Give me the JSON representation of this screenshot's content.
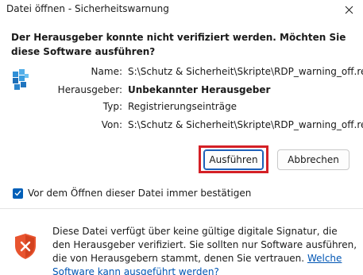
{
  "window": {
    "title": "Datei öffnen - Sicherheitswarnung",
    "close_glyph": "✕"
  },
  "dialog": {
    "heading": "Der Herausgeber konnte nicht verifiziert werden. Möchten Sie diese Software ausführen?",
    "file_icon": "registry-file-icon",
    "info": {
      "name_label": "Name:",
      "name_value": "S:\\Schutz & Sicherheit\\Skripte\\RDP_warning_off.reg",
      "publisher_label": "Herausgeber:",
      "publisher_value": "Unbekannter Herausgeber",
      "type_label": "Typ:",
      "type_value": "Registrierungseinträge",
      "from_label": "Von:",
      "from_value": "S:\\Schutz & Sicherheit\\Skripte\\RDP_warning_off.reg"
    },
    "buttons": {
      "run_label": "Ausführen",
      "cancel_label": "Abbrechen"
    },
    "checkbox": {
      "label": "Vor dem Öffnen dieser Datei immer bestätigen",
      "checked": true
    },
    "footer": {
      "shield_icon": "warning-shield-icon",
      "text": "Diese Datei verfügt über keine gültige digitale Signatur, die den Herausgeber verifiziert. Sie sollten nur Software ausführen, die von Herausgebern stammt, denen Sie vertrauen.",
      "link_text": "Welche Software kann ausgeführt werden?"
    }
  },
  "colors": {
    "accent": "#005fb8",
    "highlight": "#d42026",
    "link": "#0055b3",
    "shield": "#e8542f"
  }
}
